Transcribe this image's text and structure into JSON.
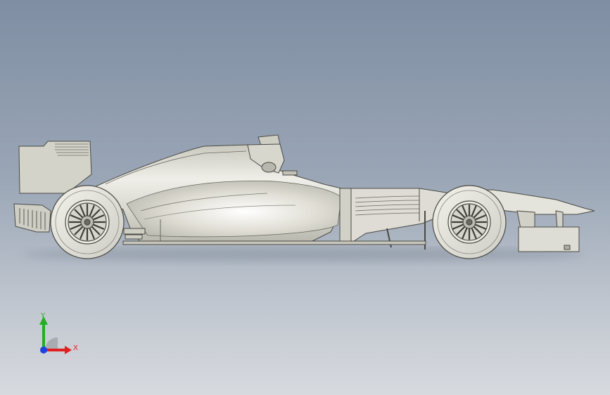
{
  "viewport": {
    "background_top": "#7f8ea3",
    "background_bottom": "#d7dadf"
  },
  "model": {
    "body_color": "#d9d8cf",
    "edge_color": "#4a4a44",
    "tire_color": "#e1e0d8"
  },
  "triad": {
    "x_label": "X",
    "y_label": "Y",
    "x_color": "#e02020",
    "y_color": "#20b020",
    "z_color": "#2040e0"
  }
}
